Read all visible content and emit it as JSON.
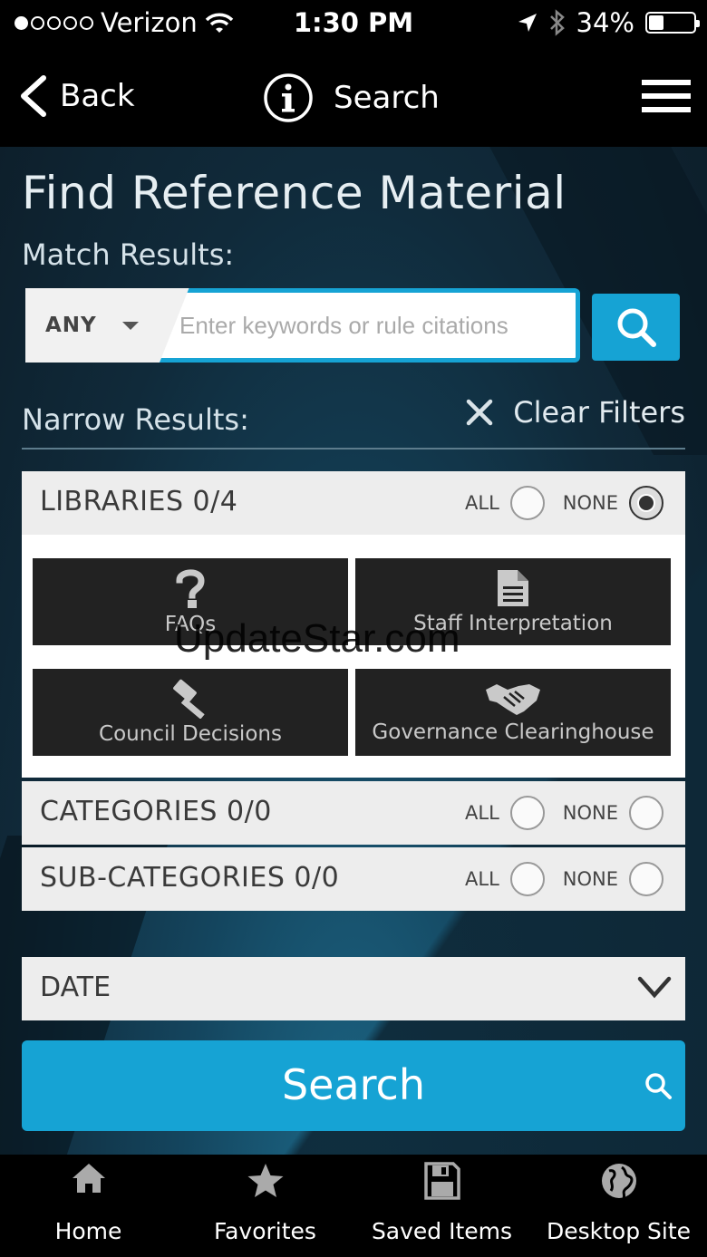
{
  "status_bar": {
    "carrier": "Verizon",
    "time": "1:30 PM",
    "battery": "34%",
    "battery_level": 0.34,
    "signal_bars_filled": 1,
    "signal_bars_total": 5
  },
  "nav": {
    "back_label": "Back",
    "title": "Search"
  },
  "page": {
    "title": "Find Reference Material",
    "match_label": "Match Results:",
    "match_mode": "ANY",
    "keyword_placeholder": "Enter keywords or rule citations",
    "narrow_label": "Narrow Results:",
    "clear_filters_label": "Clear Filters"
  },
  "filters": {
    "libraries": {
      "title": "LIBRARIES 0/4",
      "all_label": "ALL",
      "none_label": "NONE",
      "selected": "none",
      "items": [
        {
          "label": "FAQs",
          "icon": "question-icon"
        },
        {
          "label": "Staff Interpretation",
          "icon": "document-icon"
        },
        {
          "label": "Council Decisions",
          "icon": "gavel-icon"
        },
        {
          "label": "Governance Clearinghouse",
          "icon": "handshake-icon"
        }
      ]
    },
    "categories": {
      "title": "CATEGORIES 0/0",
      "all_label": "ALL",
      "none_label": "NONE"
    },
    "subcategories": {
      "title": "SUB-CATEGORIES 0/0",
      "all_label": "ALL",
      "none_label": "NONE"
    },
    "date": {
      "title": "DATE"
    }
  },
  "search_button": {
    "label": "Search"
  },
  "tabs": [
    {
      "label": "Home",
      "icon": "home-icon"
    },
    {
      "label": "Favorites",
      "icon": "star-icon"
    },
    {
      "label": "Saved Items",
      "icon": "save-icon"
    },
    {
      "label": "Desktop Site",
      "icon": "globe-icon"
    }
  ],
  "watermark": "UpdateStar.com",
  "colors": {
    "accent": "#16a3d4",
    "tile_bg": "#222222",
    "panel_bg": "#ededed"
  }
}
